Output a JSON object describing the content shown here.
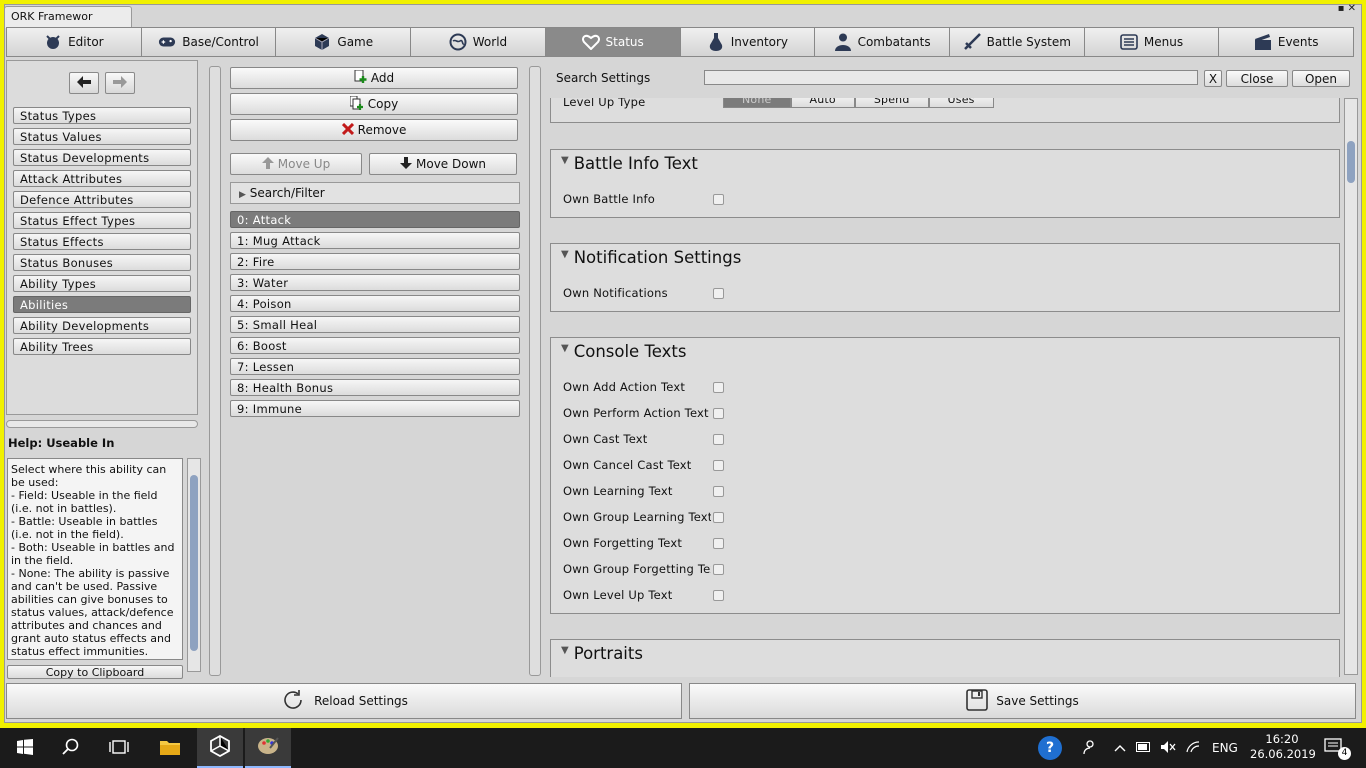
{
  "window": {
    "title": "ORK Framewor",
    "controls": "▪ ✕"
  },
  "tabs": [
    {
      "label": "Editor",
      "icon": "editor-icon"
    },
    {
      "label": "Base/Control",
      "icon": "gamepad-icon"
    },
    {
      "label": "Game",
      "icon": "cube-icon"
    },
    {
      "label": "World",
      "icon": "world-icon"
    },
    {
      "label": "Status",
      "icon": "heart-icon",
      "active": true
    },
    {
      "label": "Inventory",
      "icon": "potion-icon"
    },
    {
      "label": "Combatants",
      "icon": "person-icon"
    },
    {
      "label": "Battle System",
      "icon": "sword-icon"
    },
    {
      "label": "Menus",
      "icon": "menu-icon"
    },
    {
      "label": "Events",
      "icon": "clapper-icon"
    }
  ],
  "nav": {
    "items": [
      "Status Types",
      "Status Values",
      "Status Developments",
      "Attack Attributes",
      "Defence Attributes",
      "Status Effect Types",
      "Status Effects",
      "Status Bonuses",
      "Ability Types",
      "Abilities",
      "Ability Developments",
      "Ability Trees"
    ],
    "active_index": 9
  },
  "help": {
    "title": "Help: Useable In",
    "text": "Select where this ability can be used:\n- Field: Useable in the field (i.e. not in battles).\n- Battle: Useable in battles (i.e. not in the field).\n- Both: Useable in battles and in the field.\n- None: The ability is passive and can't be used. Passive abilities can give bonuses to status values, attack/defence attributes and chances and grant auto status effects and status effect immunities.",
    "copy_label": "Copy to Clipboard"
  },
  "mid": {
    "add": "Add",
    "copy": "Copy",
    "remove": "Remove",
    "move_up": "Move Up",
    "move_down": "Move Down",
    "search_filter": "Search/Filter",
    "items": [
      "0: Attack",
      "1: Mug Attack",
      "2: Fire",
      "3: Water",
      "4: Poison",
      "5: Small Heal",
      "6: Boost",
      "7: Lessen",
      "8: Health Bonus",
      "9: Immune"
    ],
    "active_index": 0
  },
  "search": {
    "label": "Search Settings",
    "clear": "X",
    "close": "Close",
    "open": "Open"
  },
  "levelup": {
    "label": "Level Up Type",
    "options": [
      "None",
      "Auto",
      "Spend",
      "Uses"
    ],
    "selected": 0
  },
  "sections": {
    "battle_info": {
      "title": "Battle Info Text",
      "rows": [
        "Own Battle Info"
      ]
    },
    "notification": {
      "title": "Notification Settings",
      "rows": [
        "Own Notifications"
      ]
    },
    "console": {
      "title": "Console Texts",
      "rows": [
        "Own Add Action Text",
        "Own Perform Action Text",
        "Own Cast Text",
        "Own Cancel Cast Text",
        "Own Learning Text",
        "Own Group Learning Text",
        "Own Forgetting Text",
        "Own Group Forgetting Text",
        "Own Level Up Text"
      ]
    },
    "portraits": {
      "title": "Portraits"
    }
  },
  "footer": {
    "reload": "Reload Settings",
    "save": "Save Settings"
  },
  "taskbar": {
    "lang": "ENG",
    "time": "16:20",
    "date": "26.06.2019",
    "notifications": "4"
  }
}
